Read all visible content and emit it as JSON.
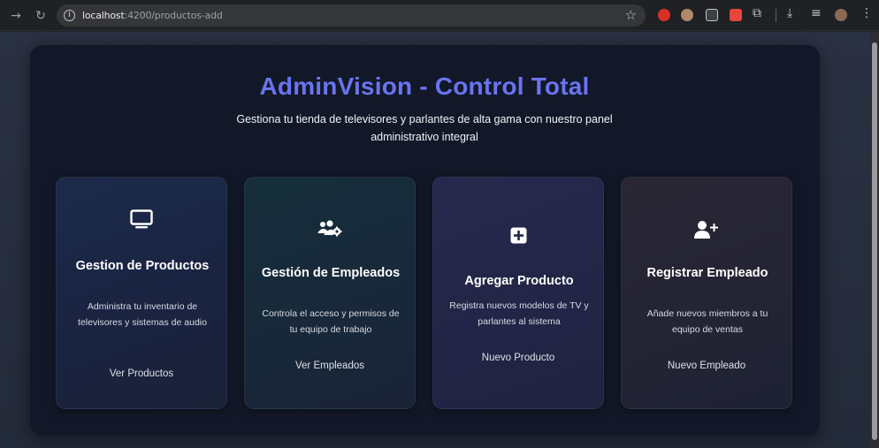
{
  "browser": {
    "url_host": "localhost",
    "url_path": ":4200/productos-add"
  },
  "hero": {
    "title": "AdminVision - Control Total",
    "subtitle": "Gestiona tu tienda de televisores y parlantes de alta gama con nuestro panel administrativo integral"
  },
  "cards": [
    {
      "icon": "tv-icon",
      "title": "Gestion de Productos",
      "description": "Administra tu inventario de televisores y sistemas de audio",
      "link": "Ver Productos"
    },
    {
      "icon": "users-gear-icon",
      "title": "Gestión de Empleados",
      "description": "Controla el acceso y permisos de tu equipo de trabajo",
      "link": "Ver Empleados"
    },
    {
      "icon": "square-plus-icon",
      "title": "Agregar Producto",
      "description": "Registra nuevos modelos de TV y parlantes al sistema",
      "link": "Nuevo Producto"
    },
    {
      "icon": "user-plus-icon",
      "title": "Registrar Empleado",
      "description": "Añade nuevos miembros a tu equipo de ventas",
      "link": "Nuevo Empleado"
    }
  ],
  "colors": {
    "title_accent": "#6a74f0",
    "panel_bg": "#121828"
  }
}
